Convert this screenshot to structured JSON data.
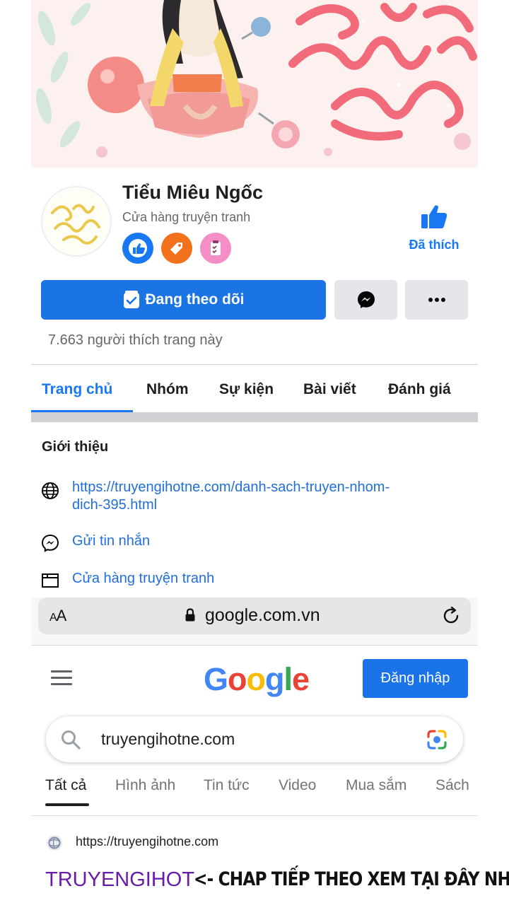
{
  "page": {
    "name": "Tiểu Miêu Ngốc",
    "category": "Cửa hàng truyện tranh",
    "liked_label": "Đã thích",
    "follow_label": "Đang theo dõi",
    "likes_count_text": "7.663 người thích trang này",
    "badges": [
      "like-badge-icon",
      "tag-badge-icon",
      "checklist-badge-icon"
    ],
    "tabs": [
      "Trang chủ",
      "Nhóm",
      "Sự kiện",
      "Bài viết",
      "Đánh giá"
    ],
    "active_tab": "Trang chủ"
  },
  "intro": {
    "title": "Giới thiệu",
    "website": "https://truyengihotne.com/danh-sach-truyen-nhom-dich-395.html",
    "website_line1": "https://truyengihotne.com/danh-sach-truyen-nhom-",
    "website_line2": "dich-395.html",
    "message": "Gửi tin nhắn",
    "category": "Cửa hàng truyện tranh"
  },
  "browser": {
    "text_size_label": "AA",
    "url": "google.com.vn"
  },
  "google": {
    "logo_letters": [
      "G",
      "o",
      "o",
      "g",
      "l",
      "e"
    ],
    "signin_label": "Đăng nhập",
    "query": "truyengihotne.com",
    "tabs": [
      "Tất cả",
      "Hình ảnh",
      "Tin tức",
      "Video",
      "Mua sắm",
      "Sách"
    ],
    "active_tab": "Tất cả",
    "result": {
      "url": "https://truyengihotne.com",
      "title": "TRUYENGIHOT",
      "note": "<- CHAP TIẾP THEO XEM TẠI ĐÂY NHA"
    }
  },
  "colors": {
    "facebook_blue": "#1b74e4",
    "link_blue": "#216fdb",
    "google_blue": "#4285f4",
    "google_red": "#ea4335",
    "google_yellow": "#fbbc05",
    "google_green": "#34a853",
    "visited_purple": "#681da8"
  }
}
